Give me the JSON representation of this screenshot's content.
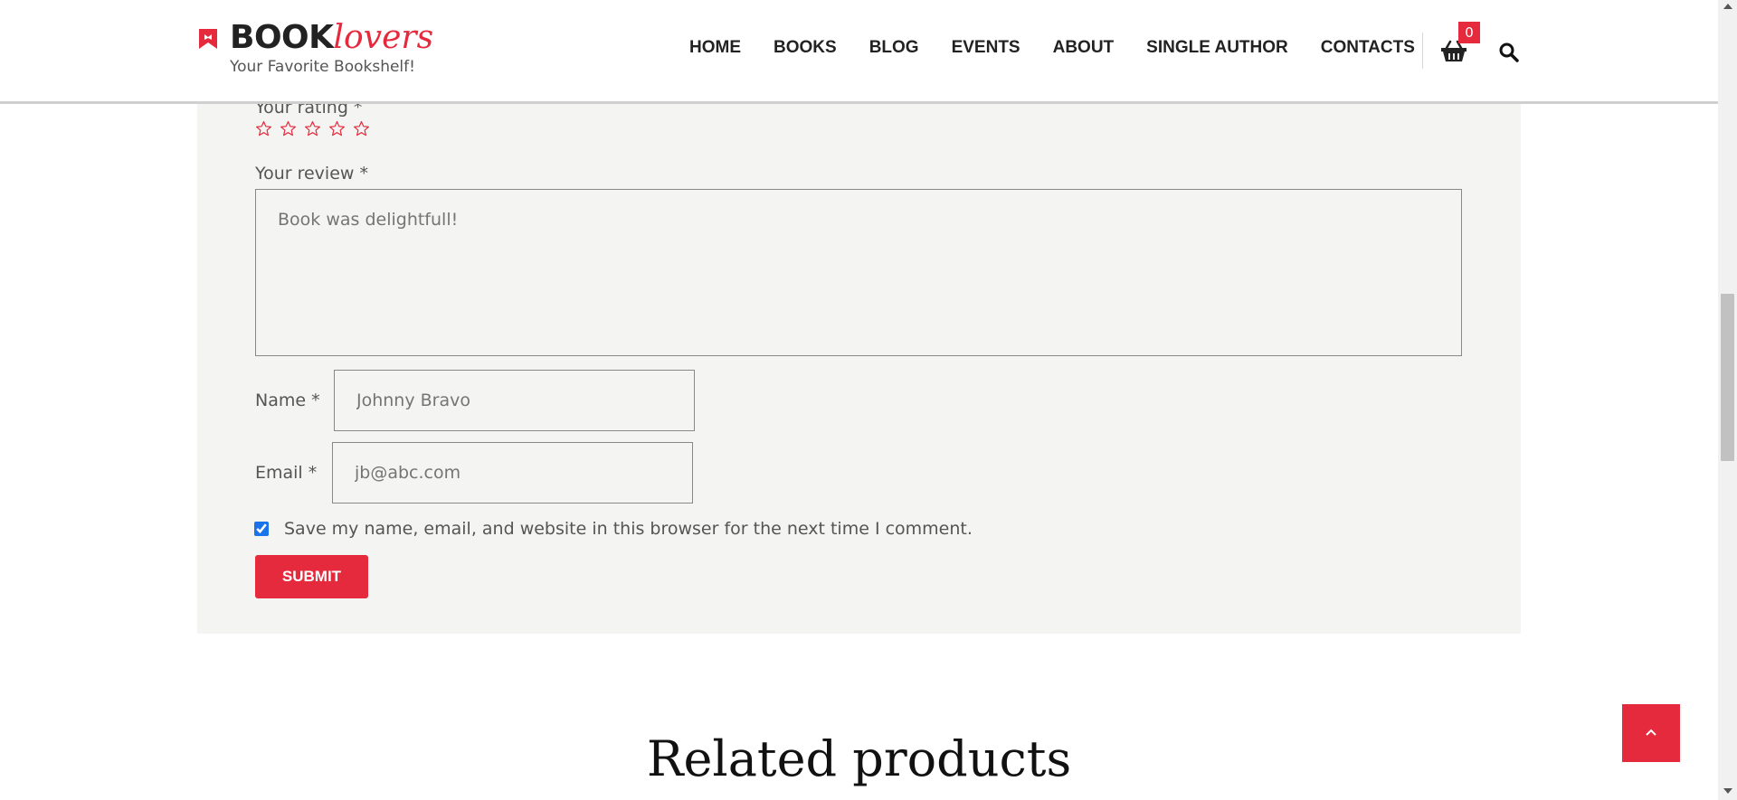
{
  "header": {
    "logo_book": "BOOK",
    "logo_lovers": "lovers",
    "tagline": "Your Favorite Bookshelf!",
    "nav": [
      "HOME",
      "BOOKS",
      "BLOG",
      "EVENTS",
      "ABOUT",
      "SINGLE AUTHOR",
      "CONTACTS"
    ],
    "cart_count": "0",
    "cart_icon": "basket-icon",
    "search_icon": "search-icon"
  },
  "review_form": {
    "rating_label": "Your rating *",
    "rating_value": 0,
    "rating_max": 5,
    "review_label": "Your review *",
    "review_placeholder": "Book was delightfull!",
    "name_label": "Name *",
    "name_placeholder": "Johnny Bravo",
    "email_label": "Email *",
    "email_placeholder": "jb@abc.com",
    "save_info_text": "Save my name, email, and website in this browser for the next time I comment.",
    "save_info_checked": true,
    "submit_label": "SUBMIT"
  },
  "related": {
    "heading": "Related products"
  },
  "colors": {
    "accent": "#e52a3d",
    "form_background": "#f4f4f2"
  }
}
